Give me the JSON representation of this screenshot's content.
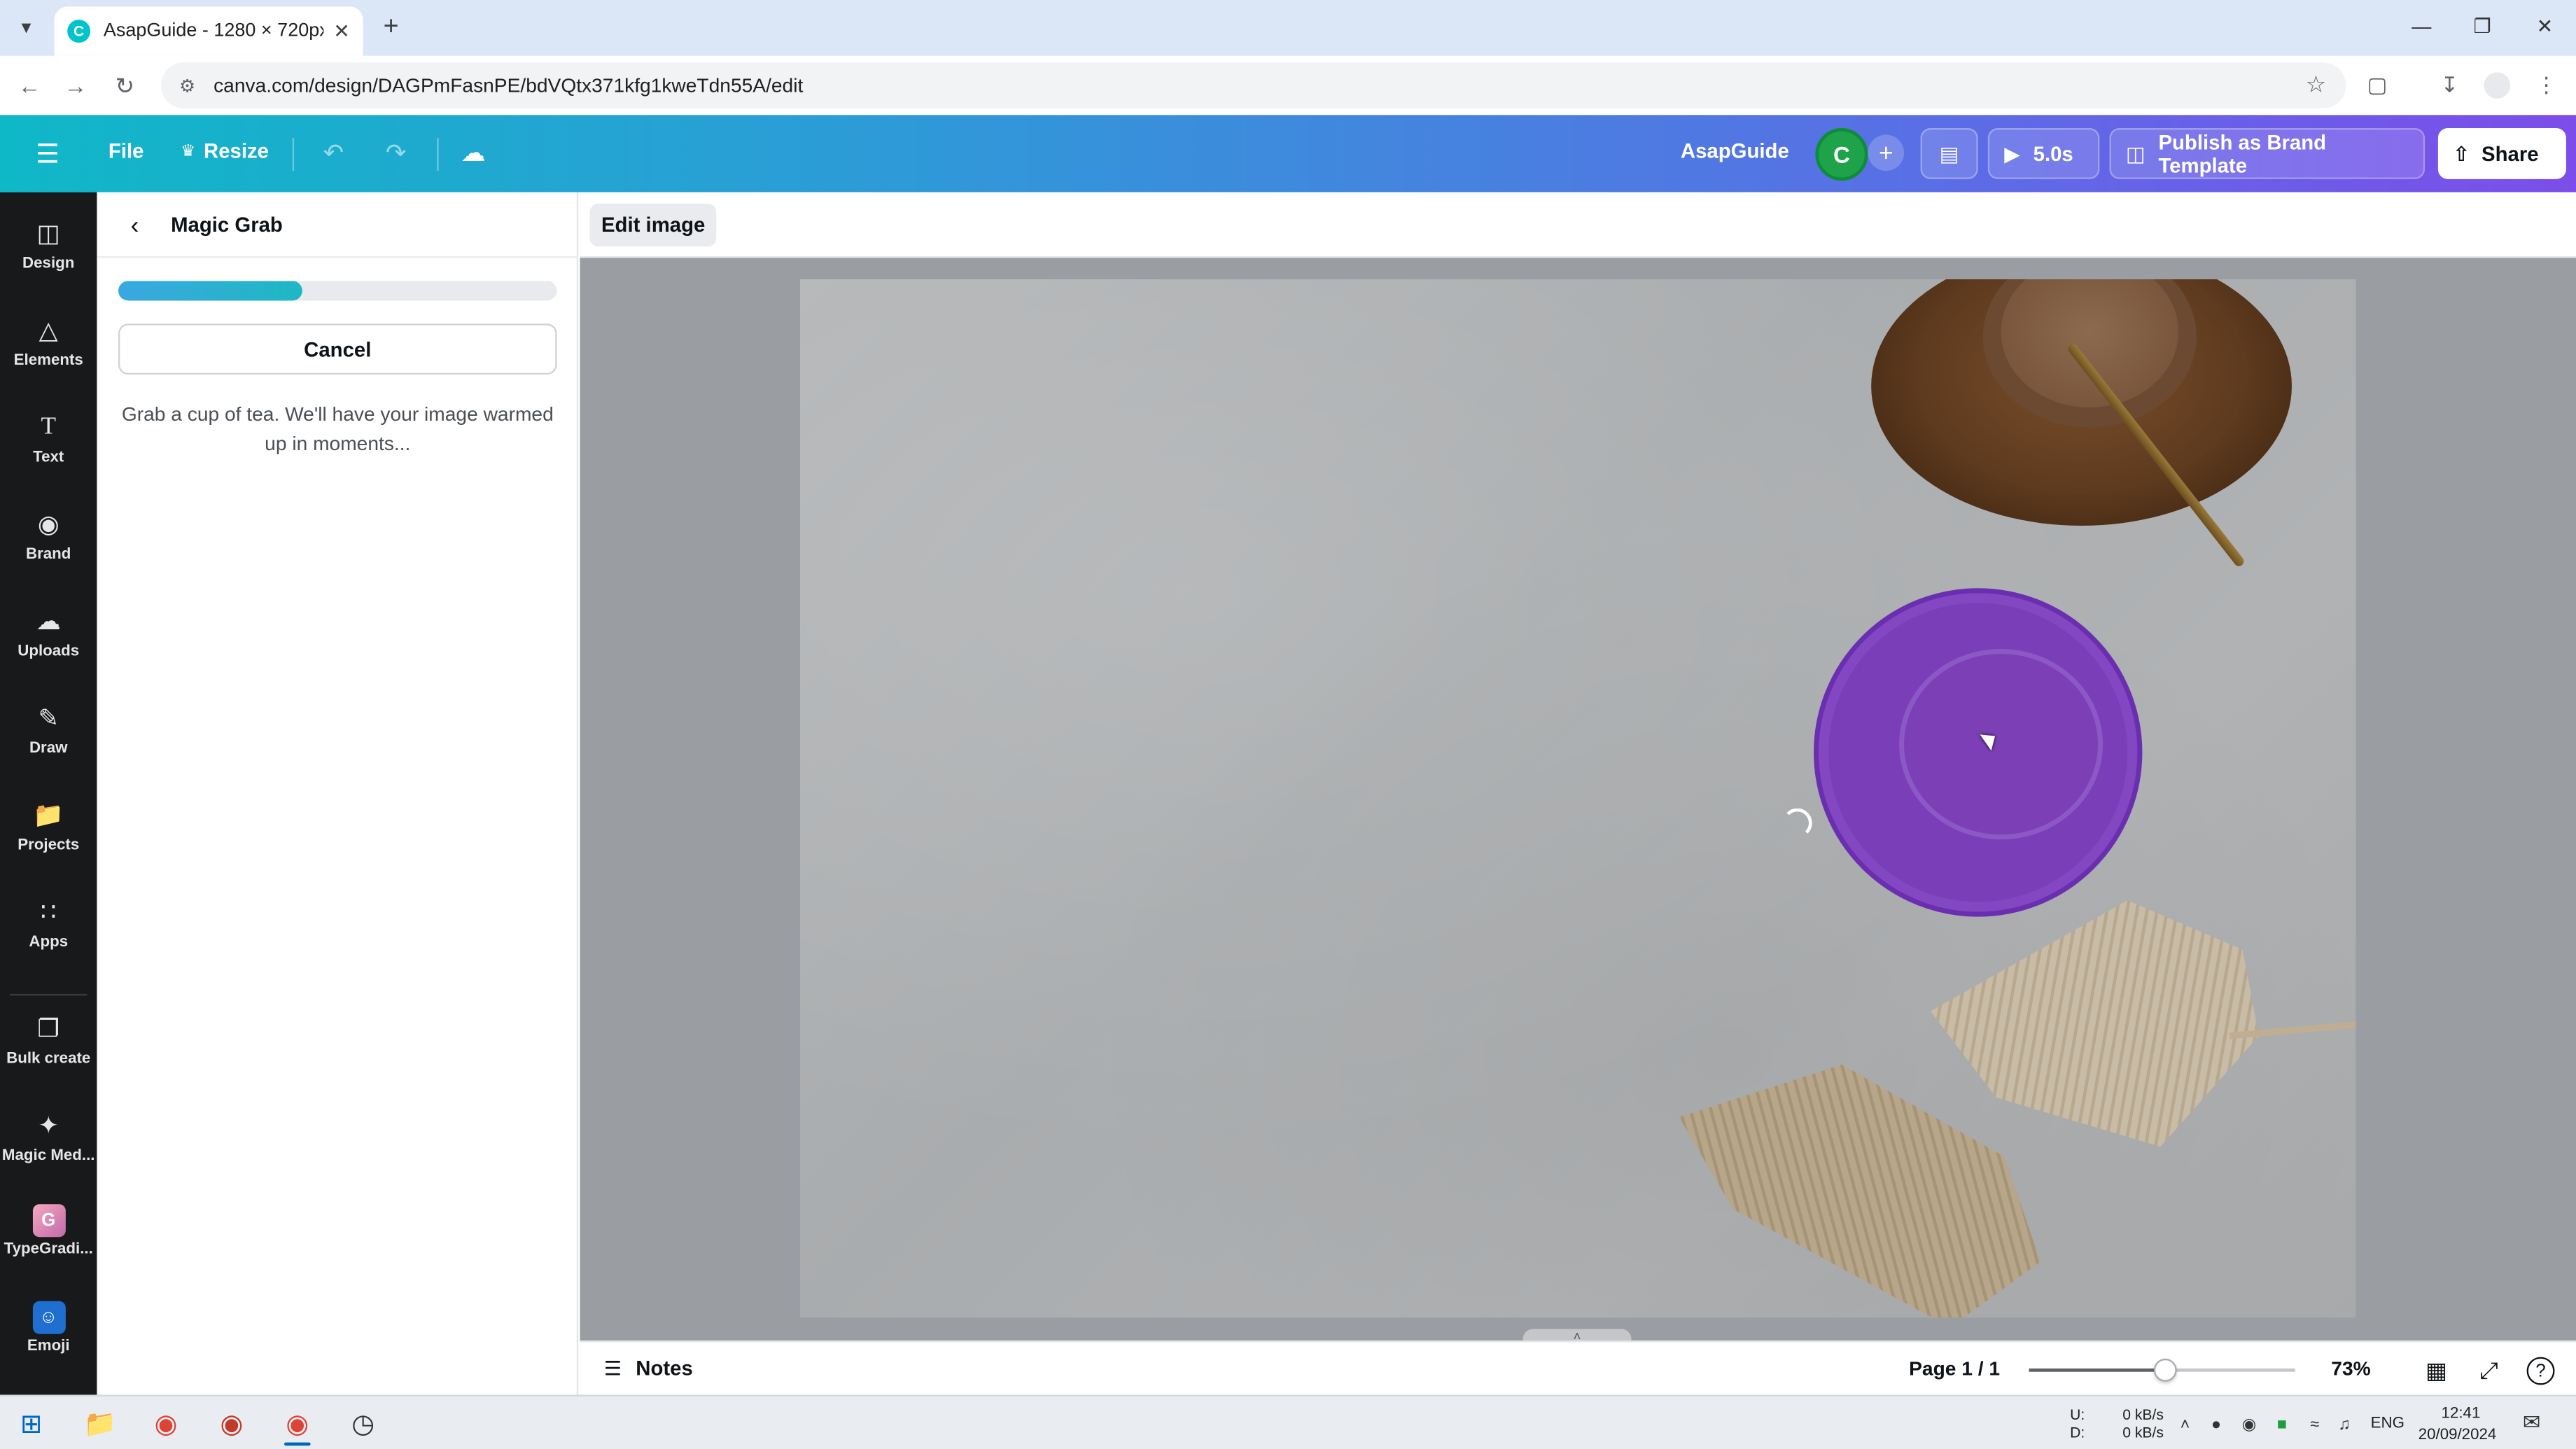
{
  "browser": {
    "tab_title": "AsapGuide - 1280 × 720px",
    "url": "canva.com/design/DAGPmFasnPE/bdVQtx371kfg1kweTdn55A/edit"
  },
  "header": {
    "file_label": "File",
    "resize_label": "Resize",
    "project_name": "AsapGuide",
    "avatar_initial": "C",
    "play_duration": "5.0s",
    "publish_label": "Publish as Brand Template",
    "share_label": "Share"
  },
  "rail": {
    "items": [
      {
        "label": "Design",
        "icon": "design-icon"
      },
      {
        "label": "Elements",
        "icon": "elements-icon"
      },
      {
        "label": "Text",
        "icon": "text-icon"
      },
      {
        "label": "Brand",
        "icon": "brand-icon"
      },
      {
        "label": "Uploads",
        "icon": "uploads-icon"
      },
      {
        "label": "Draw",
        "icon": "draw-icon"
      },
      {
        "label": "Projects",
        "icon": "projects-icon"
      },
      {
        "label": "Apps",
        "icon": "apps-icon"
      },
      {
        "label": "Bulk create",
        "icon": "bulk-create-icon"
      },
      {
        "label": "Magic Med...",
        "icon": "magic-media-icon"
      },
      {
        "label": "TypeGradi...",
        "icon": "typegradient-icon"
      },
      {
        "label": "Emoji",
        "icon": "emoji-icon"
      }
    ]
  },
  "panel": {
    "title": "Magic Grab",
    "progress": 0.42,
    "cancel_label": "Cancel",
    "message": "Grab a cup of tea. We'll have your image warmed up in moments..."
  },
  "context_bar": {
    "edit_image_label": "Edit image"
  },
  "footer": {
    "notes_label": "Notes",
    "page_indicator": "Page 1 / 1",
    "zoom_percent": "73%",
    "zoom_level": 0.51
  },
  "taskbar": {
    "net_up_label": "U:",
    "net_down_label": "D:",
    "net_up_value": "0 kB/s",
    "net_down_value": "0 kB/s",
    "lang": "ENG",
    "time": "12:41",
    "date": "20/09/2024"
  },
  "colors": {
    "header_gradient_start": "#0fb8c7",
    "header_gradient_end": "#7c4dea",
    "magic_grab_highlight": "#7a3fb8",
    "rail_bg": "#18191b"
  }
}
